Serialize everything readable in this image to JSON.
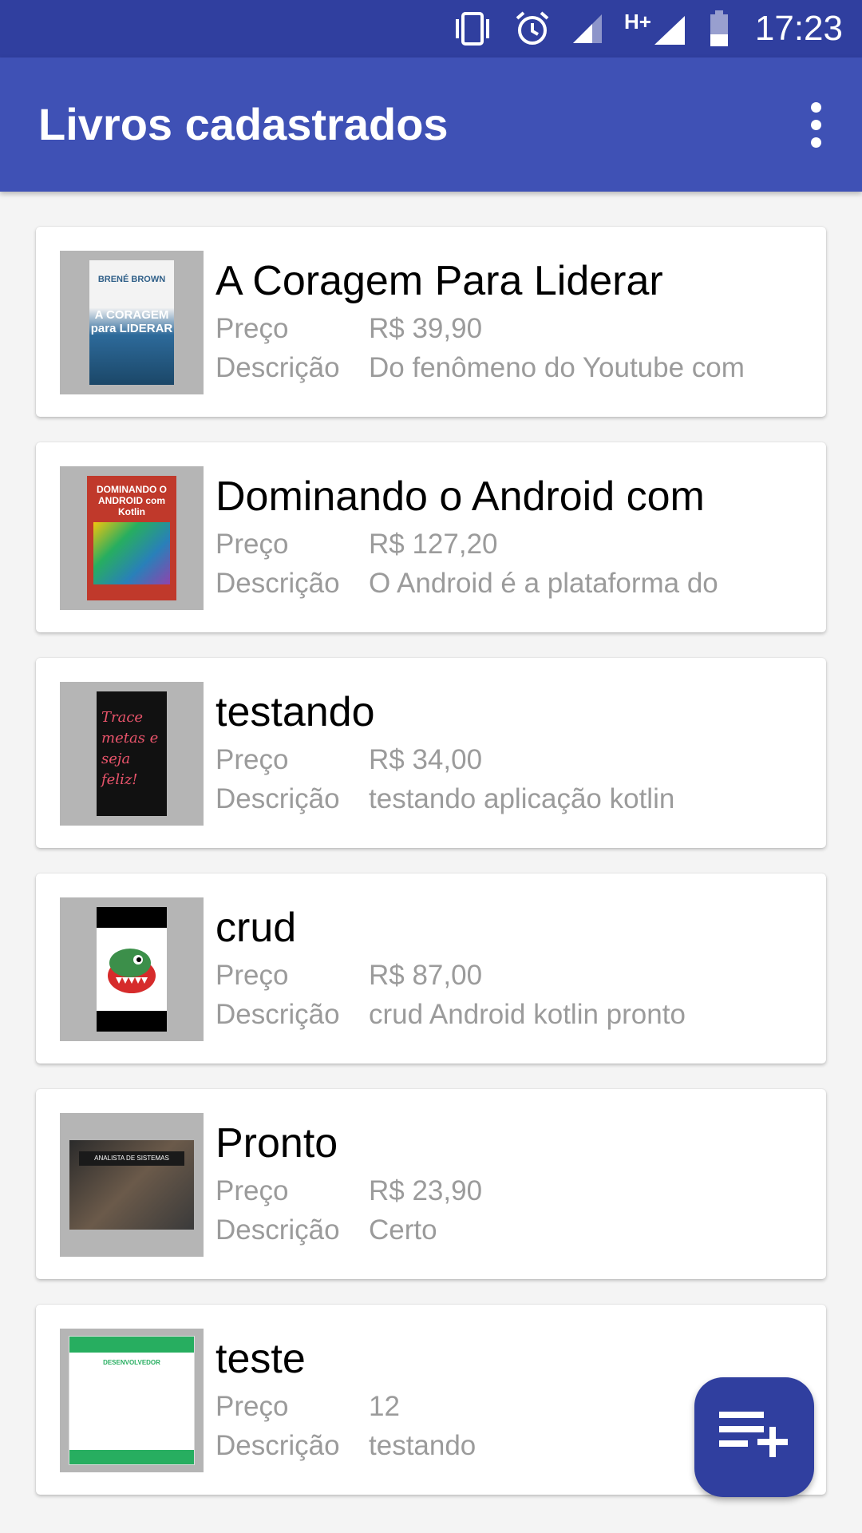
{
  "status_bar": {
    "time": "17:23"
  },
  "app_bar": {
    "title": "Livros cadastrados",
    "menu_icon": "more-vert-icon"
  },
  "labels": {
    "price": "Preço",
    "description": "Descrição"
  },
  "books": [
    {
      "title": "A Coragem Para Liderar",
      "price": "R$ 39,90",
      "description": "Do fenômeno do Youtube com",
      "cover_author": "BRENÉ BROWN",
      "cover_title": "A CORAGEM para LIDERAR"
    },
    {
      "title": "Dominando o Android com",
      "price": "R$ 127,20",
      "description": "O Android é a plataforma do",
      "cover_title": "DOMINANDO O ANDROID com Kotlin"
    },
    {
      "title": "testando",
      "price": "R$ 34,00",
      "description": "testando aplicação kotlin",
      "cover_title": "Trace metas e seja feliz!"
    },
    {
      "title": "crud",
      "price": "R$ 87,00",
      "description": "crud Android kotlin pronto"
    },
    {
      "title": "Pronto",
      "price": "R$ 23,90",
      "description": "Certo",
      "cover_title": "ANALISTA DE SISTEMAS"
    },
    {
      "title": "teste",
      "price": "12",
      "description": "testando",
      "cover_title": "DESENVOLVEDOR"
    }
  ],
  "fab": {
    "icon": "playlist-add-icon"
  },
  "colors": {
    "status_bar": "#303f9f",
    "app_bar": "#3f51b5",
    "fab": "#303f9f"
  }
}
